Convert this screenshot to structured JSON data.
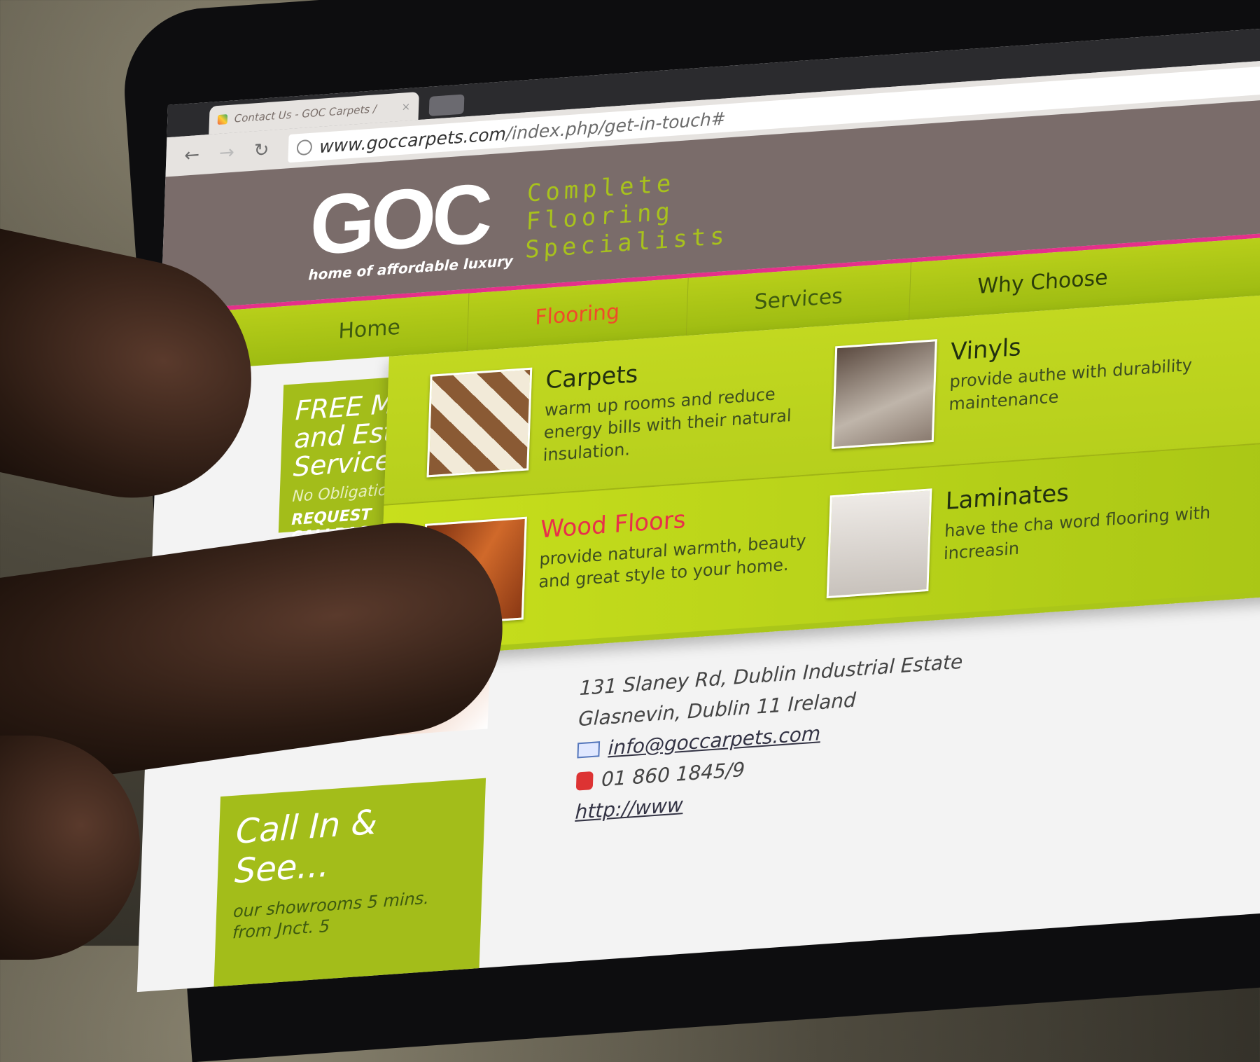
{
  "browser": {
    "tab_title": "Contact Us - GOC Carpets /",
    "tab_close": "×",
    "url_host": "www.goccarpets.com",
    "url_path": "/index.php/get-in-touch#"
  },
  "header": {
    "logo": "GOC",
    "logo_tagline": "home of affordable luxury",
    "slogan": [
      "Complete",
      "Flooring",
      "Specialists"
    ]
  },
  "nav": {
    "items": [
      "Home",
      "Flooring",
      "Services",
      "Why Choose"
    ],
    "active": "Flooring"
  },
  "flooring_menu": [
    {
      "title": "Carpets",
      "desc": "warm up rooms and reduce energy bills with their natural insulation."
    },
    {
      "title": "Vinyls",
      "desc": "provide authe with durability maintenance"
    },
    {
      "title": "Wood Floors",
      "desc": "provide natural warmth, beauty and great style to your home."
    },
    {
      "title": "Laminates",
      "desc": "have the cha word flooring with increasin"
    }
  ],
  "promo": {
    "headline": "FREE Mea and Estim Service",
    "sub": "No Obligation",
    "cta": "REQUEST CALLBAC"
  },
  "promo2": {
    "headline": "Call In & See...",
    "text": "our showrooms 5 mins. from Jnct. 5"
  },
  "contact": {
    "address1": "131 Slaney Rd, Dublin Industrial Estate",
    "address2": "Glasnevin, Dublin 11 Ireland",
    "email": "info@goccarpets.com",
    "phone": "01 860 1845/9",
    "web": "http://www"
  },
  "colors": {
    "header_bg": "#7a6c6a",
    "accent_green": "#a8c21c",
    "accent_pink": "#e5308a",
    "active_nav": "#f04a2a"
  }
}
